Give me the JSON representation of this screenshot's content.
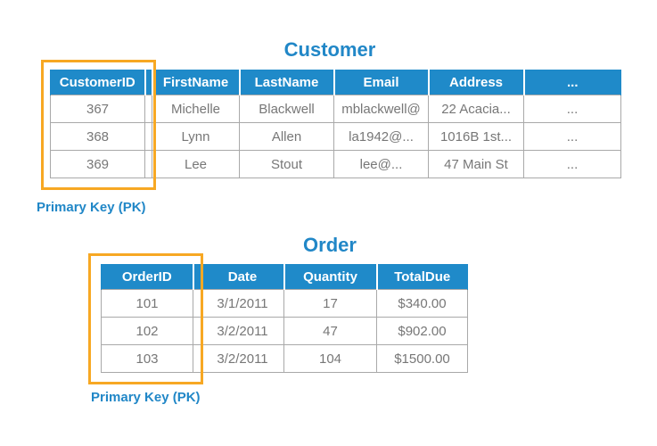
{
  "customer": {
    "title": "Customer",
    "columns": [
      "CustomerID",
      "FirstName",
      "LastName",
      "Email",
      "Address",
      "..."
    ],
    "rows": [
      [
        "367",
        "Michelle",
        "Blackwell",
        "mblackwell@",
        "22 Acacia...",
        "..."
      ],
      [
        "368",
        "Lynn",
        "Allen",
        "la1942@...",
        "1016B 1st...",
        "..."
      ],
      [
        "369",
        "Lee",
        "Stout",
        "lee@...",
        "47 Main St",
        "..."
      ]
    ],
    "pk_label": "Primary Key (PK)"
  },
  "order": {
    "title": "Order",
    "columns": [
      "OrderID",
      "Date",
      "Quantity",
      "TotalDue"
    ],
    "rows": [
      [
        "101",
        "3/1/2011",
        "17",
        "$340.00"
      ],
      [
        "102",
        "3/2/2011",
        "47",
        "$902.00"
      ],
      [
        "103",
        "3/2/2011",
        "104",
        "$1500.00"
      ]
    ],
    "pk_label": "Primary Key (PK)"
  },
  "colors": {
    "header_blue": "#1f8ac9",
    "title_blue": "#2187c7",
    "pk_highlight": "#f7a823",
    "cell_text": "#777777",
    "grid": "#a9a9a9"
  }
}
